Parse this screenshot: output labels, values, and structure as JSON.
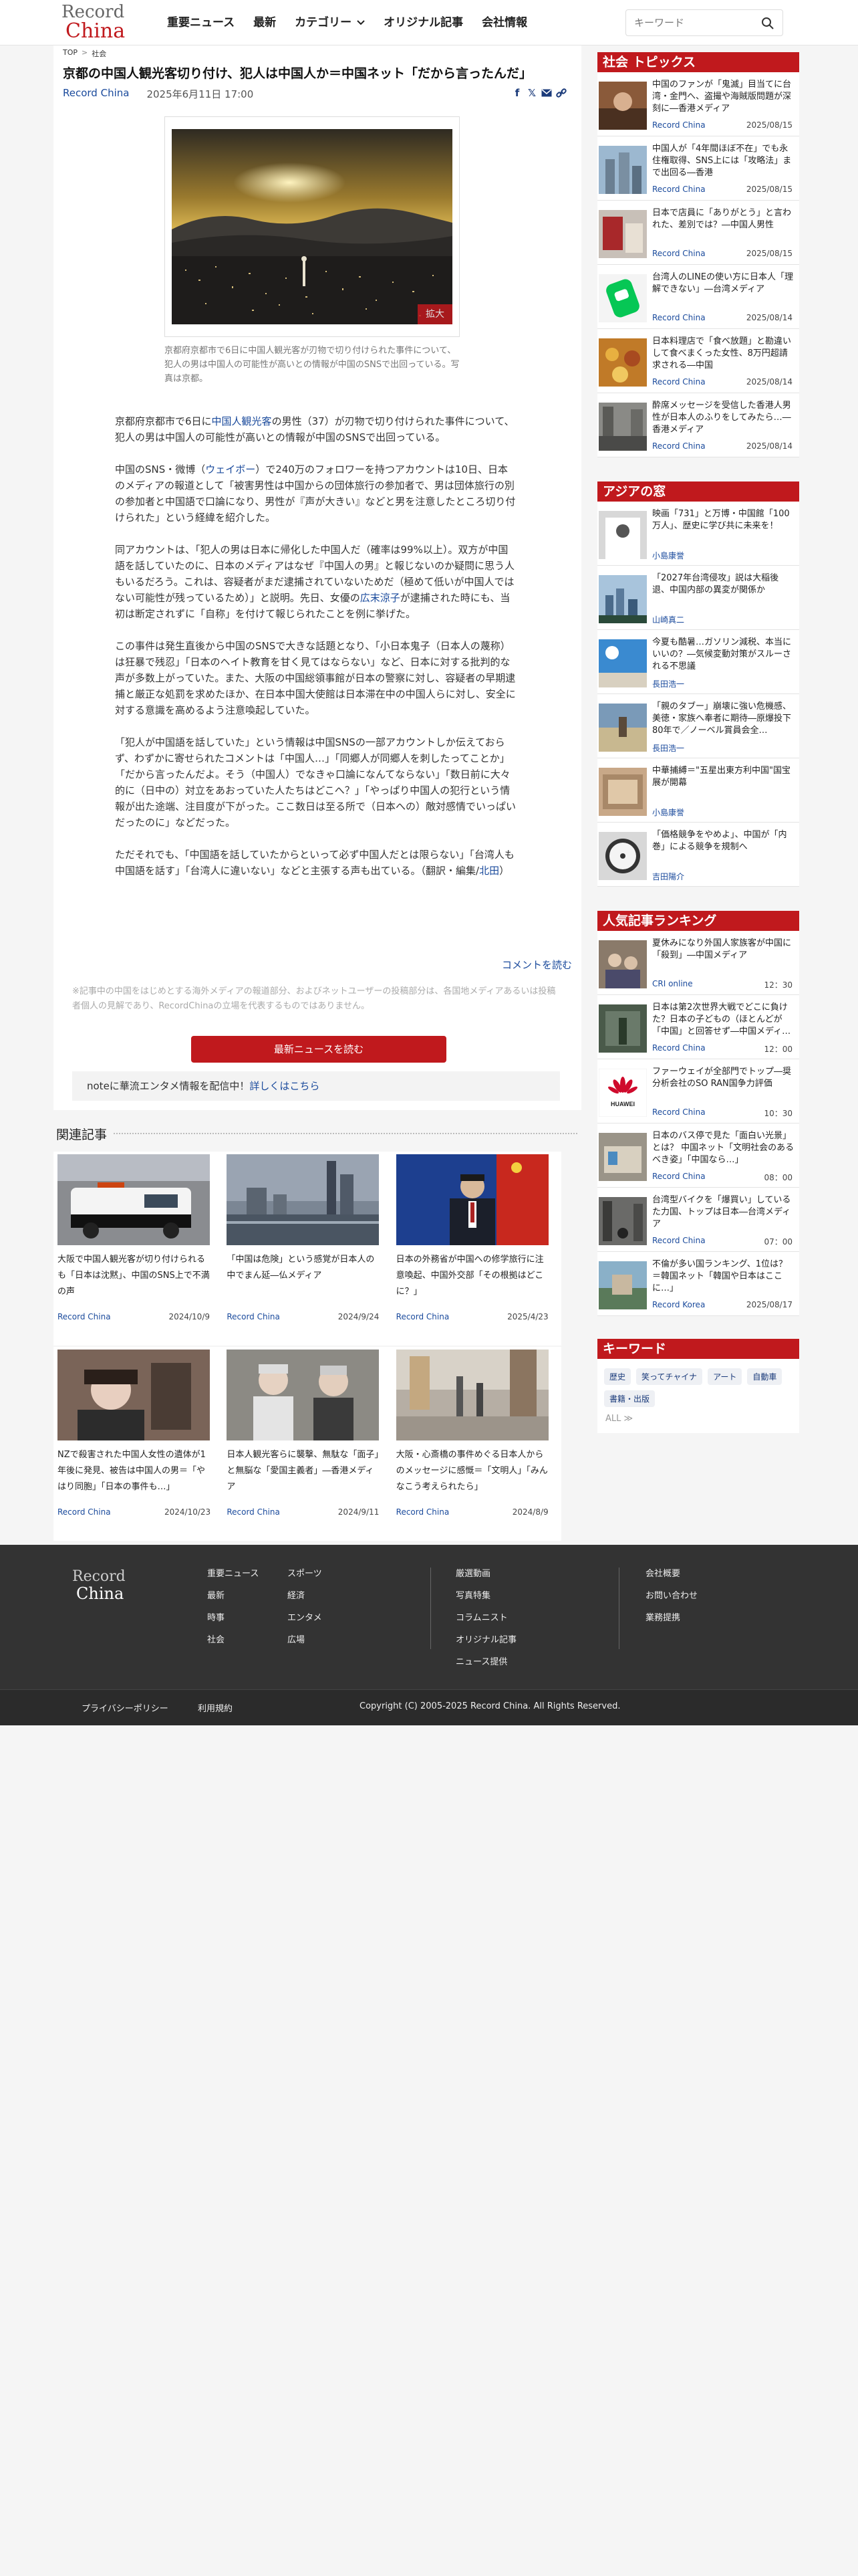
{
  "header": {
    "logo_line1": "Record",
    "logo_line2": "China",
    "nav": [
      "重要ニュース",
      "最新",
      "カテゴリー",
      "オリジナル記事",
      "会社情報"
    ],
    "search_placeholder": "キーワード"
  },
  "breadcrumb": [
    "TOP",
    "社会"
  ],
  "article": {
    "title": "京都の中国人観光客切り付け、犯人は中国人か＝中国ネット「だから言ったんだ」",
    "source": "Record China",
    "datetime": "2025年6月11日 17:00",
    "zoom_label": "拡大",
    "caption": "京都府京都市で6日に中国人観光客が刃物で切り付けられた事件について、犯人の男は中国人の可能性が高いとの情報が中国のSNSで出回っている。写真は京都。",
    "paragraphs": [
      {
        "a": "京都府京都市で6日に",
        "link": "中国人観光客",
        "b": "の男性（37）が刃物で切り付けられた事件について、犯人の男は中国人の可能性が高いとの情報が中国のSNSで出回っている。"
      },
      {
        "a": "中国のSNS・微博（",
        "link": "ウェイボー",
        "b": "）で240万のフォロワーを持つアカウントは10日、日本のメディアの報道として「被害男性は中国からの団体旅行の参加者で、男は団体旅行の別の参加者と中国語で口論になり、男性が『声が大きい』などと男を注意したところ切り付けられた」という経緯を紹介した。"
      },
      {
        "a": "同アカウントは、「犯人の男は日本に帰化した中国人だ（確率は99%以上）。双方が中国語を話していたのに、日本のメディアはなぜ『中国人の男』と報じないのか疑問に思う人もいるだろう。これは、容疑者がまだ逮捕されていないためだ（極めて低いが中国人ではない可能性が残っているため）」と説明。先日、女優の",
        "link": "広末涼子",
        "b": "が逮捕された時にも、当初は断定されずに「自称」を付けて報じられたことを例に挙げた。"
      },
      {
        "a": "この事件は発生直後から中国のSNSで大きな話題となり、「小日本鬼子（日本人の蔑称）は狂暴で残忍」「日本のヘイト教育を甘く見てはならない」など、日本に対する批判的な声が多数上がっていた。また、大阪の中国総領事館が日本の警察に対し、容疑者の早期逮捕と厳正な処罰を求めたほか、在日本中国大使館は日本滞在中の中国人らに対し、安全に対する意識を高めるよう注意喚起していた。",
        "link": "",
        "b": ""
      },
      {
        "a": "「犯人が中国語を話していた」という情報は中国SNSの一部アカウントしか伝えておらず、わずかに寄せられたコメントは「中国人…」「同郷人が同郷人を刺したってことか」「だから言ったんだよ。そう（中国人）でなきゃ口論になんてならない」「数日前に大々的に（日中の）対立をあおっていた人たちはどこへ？」「やっぱり中国人の犯行という情報が出た途端、注目度が下がった。ここ数日は至る所で（日本への）敵対感情でいっぱいだったのに」などだった。",
        "link": "",
        "b": ""
      },
      {
        "a": "ただそれでも、「中国語を話していたからといって必ず中国人だとは限らない」「台湾人も中国語を話す」「台湾人に違いない」などと主張する声も出ている。（翻訳・編集/",
        "link": "北田",
        "b": "）"
      }
    ],
    "comment_link": "コメントを読む",
    "disclaimer": "※記事中の中国をはじめとする海外メディアの報道部分、およびネットユーザーの投稿部分は、各国地メディアあるいは投稿者個人の見解であり、RecordChinaの立場を代表するものではありません。",
    "latest_button": "最新ニュースを読む",
    "note_text": "noteに華流エンタメ情報を配信中！",
    "note_link": "詳しくはこちら"
  },
  "related": {
    "heading": "関連記事",
    "items": [
      {
        "title": "大阪で中国人観光客が切り付けられるも「日本は沈黙」、中国のSNS上で不満の声",
        "source": "Record China",
        "date": "2024/10/9"
      },
      {
        "title": "「中国は危険」という感覚が日本人の中でまん延―仏メディア",
        "source": "Record China",
        "date": "2024/9/24"
      },
      {
        "title": "日本の外務省が中国への修学旅行に注意喚起、中国外交部「その根拠はどこに？」",
        "source": "Record China",
        "date": "2025/4/23"
      },
      {
        "title": "NZで殺害された中国人女性の遺体が1年後に発見、被告は中国人の男＝「やはり同胞」「日本の事件も…」",
        "source": "Record China",
        "date": "2024/10/23"
      },
      {
        "title": "日本人観光客らに襲撃、無駄な「面子」と無脳な「愛国主義者」―香港メディア",
        "source": "Record China",
        "date": "2024/9/11"
      },
      {
        "title": "大阪・心斎橋の事件めぐる日本人からのメッセージに感慨＝「文明人」「みんなこう考えられたら」",
        "source": "Record China",
        "date": "2024/8/9"
      }
    ]
  },
  "sidebar": {
    "topics_heading": "社会 トピックス",
    "topics": [
      {
        "title": "中国のファンが「鬼滅」目当てに台湾・金門へ、盗撮や海賊版問題が深刻に―香港メディア",
        "source": "Record China",
        "date": "2025/08/15"
      },
      {
        "title": "中国人が「4年間ほぼ不在」でも永住権取得、SNS上には「攻略法」まで出回る―香港",
        "source": "Record China",
        "date": "2025/08/15"
      },
      {
        "title": "日本で店員に「ありがとう」と言われた、差別では？―中国人男性",
        "source": "Record China",
        "date": "2025/08/15"
      },
      {
        "title": "台湾人のLINEの使い方に日本人「理解できない」―台湾メディア",
        "source": "Record China",
        "date": "2025/08/14"
      },
      {
        "title": "日本料理店で「食べ放題」と勘違いして食べまくった女性、8万円超請求される―中国",
        "source": "Record China",
        "date": "2025/08/14"
      },
      {
        "title": "酔席メッセージを受信した香港人男性が日本人のふりをしてみたら…―香港メディア",
        "source": "Record China",
        "date": "2025/08/14"
      }
    ],
    "asia_heading": "アジアの窓",
    "asia": [
      {
        "title": "映画「731」と万博・中国館「100万人」、歴史に学び共に未来を！",
        "source": "小島康誉",
        "date": ""
      },
      {
        "title": "「2027年台湾侵攻」説は大稲後退、中国内部の異変が関係か",
        "source": "山崎真二",
        "date": ""
      },
      {
        "title": "今夏も酷暑…ガソリン減税、本当にいいの？―気候変動対策がスルーされる不思議",
        "source": "長田浩一",
        "date": ""
      },
      {
        "title": "「親のタブー」崩壊に強い危機感、美徳・家族へ奉者に期待―原爆投下80年で／ノーベル賞員会全…",
        "source": "長田浩一",
        "date": ""
      },
      {
        "title": "中華捕縛＝\"五星出東方利中国\"国宝展が開幕",
        "source": "小島康誉",
        "date": ""
      },
      {
        "title": "「価格競争をやめよ」、中国が「内巻」による競争を規制へ",
        "source": "吉田陽介",
        "date": ""
      }
    ],
    "ranking_heading": "人気記事ランキング",
    "ranking": [
      {
        "title": "夏休みになり外国人家族客が中国に「殺到」―中国メディア",
        "source": "CRI online",
        "date": "12：30"
      },
      {
        "title": "日本は第2次世界大戦でどこに負けた？日本の子どもの（ほとんどが「中国」と回答せず―中国メディ…",
        "source": "Record China",
        "date": "12：00"
      },
      {
        "title": "ファーウェイが全部門でトップ―奨分析会社のSO RAN国争力評価",
        "source": "Record China",
        "date": "10：30"
      },
      {
        "title": "日本のバス停で見た「面白い光景」とは？ 中国ネット「文明社会のあるべき姿」「中国なら…」",
        "source": "Record China",
        "date": "08：00"
      },
      {
        "title": "台湾型バイクを「爆買い」しているた力国、トップは日本―台湾メディア",
        "source": "Record China",
        "date": "07：00"
      },
      {
        "title": "不倫が多い国ランキング、1位は？＝韓国ネット「韓国や日本はここに…」",
        "source": "Record Korea",
        "date": "2025/08/17"
      }
    ],
    "keyword_heading": "キーワード",
    "keywords": [
      "歴史",
      "笑ってチャイナ",
      "アート",
      "自動車",
      "書籍・出版"
    ],
    "keywords_all": "ALL ≫"
  },
  "footer": {
    "logo_line1": "Record",
    "logo_line2": "China",
    "col1": [
      "重要ニュース",
      "最新",
      "時事",
      "社会"
    ],
    "col2": [
      "スポーツ",
      "経済",
      "エンタメ",
      "広場"
    ],
    "col3": [
      "厳選動画",
      "写真特集",
      "コラムニスト",
      "オリジナル記事",
      "ニュース提供"
    ],
    "col4": [
      "会社概要",
      "お問い合わせ",
      "業務提携"
    ],
    "privacy": "プライバシーポリシー",
    "terms": "利用規約",
    "copyright": "Copyright (C) 2005-2025 Record China. All Rights Reserved."
  }
}
